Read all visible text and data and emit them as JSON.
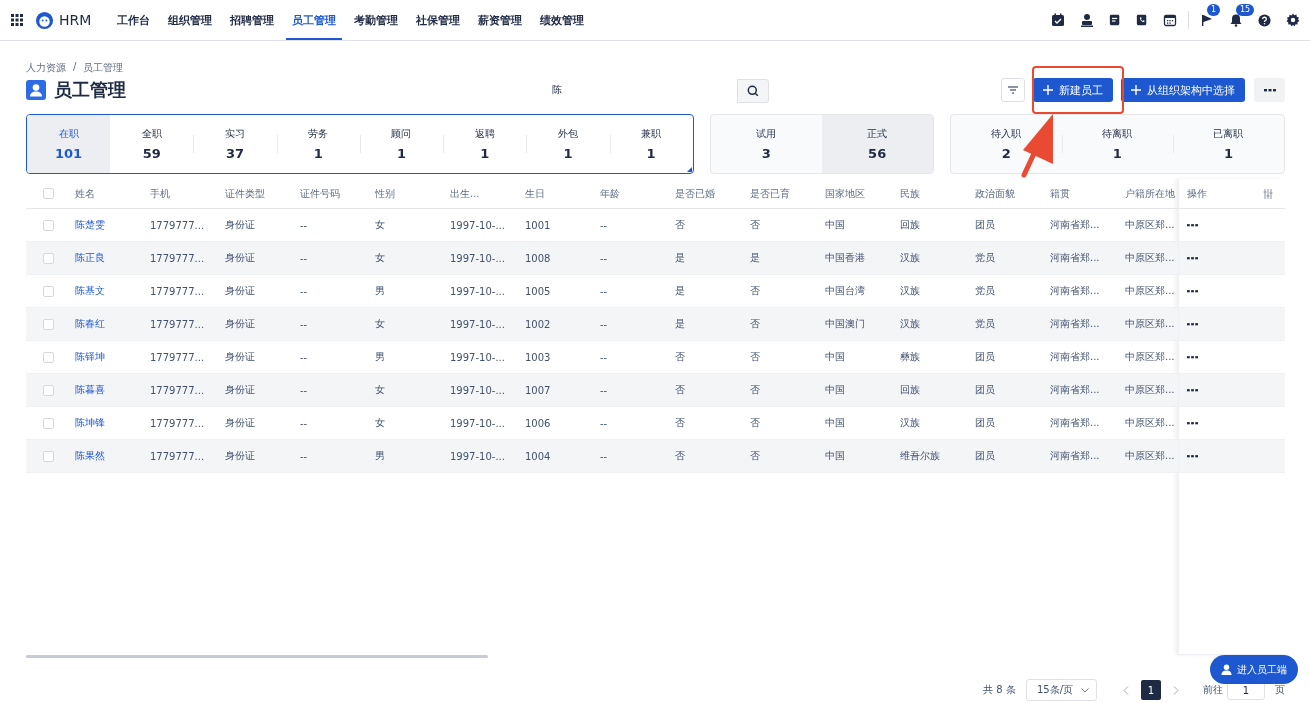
{
  "app": {
    "name": "HRM"
  },
  "nav": [
    {
      "label": "工作台",
      "selected": false
    },
    {
      "label": "组织管理",
      "selected": false
    },
    {
      "label": "招聘管理",
      "selected": false
    },
    {
      "label": "员工管理",
      "selected": true
    },
    {
      "label": "考勤管理",
      "selected": false
    },
    {
      "label": "社保管理",
      "selected": false
    },
    {
      "label": "薪资管理",
      "selected": false
    },
    {
      "label": "绩效管理",
      "selected": false
    }
  ],
  "header_badges": {
    "flag": "1",
    "bell": "15"
  },
  "breadcrumb": [
    "人力资源",
    "员工管理"
  ],
  "breadcrumb_separator": "/",
  "page_title": "员工管理",
  "search": {
    "value": "陈"
  },
  "buttons": {
    "primary": [
      "新建员工",
      "从组织架构中选择"
    ]
  },
  "stat_groups": [
    {
      "items": [
        {
          "label": "在职",
          "value": "101",
          "selected": true
        },
        {
          "label": "全职",
          "value": "59",
          "selected": false
        },
        {
          "label": "实习",
          "value": "37",
          "selected": false
        },
        {
          "label": "劳务",
          "value": "1",
          "selected": false
        },
        {
          "label": "顾问",
          "value": "1",
          "selected": false
        },
        {
          "label": "返聘",
          "value": "1",
          "selected": false
        },
        {
          "label": "外包",
          "value": "1",
          "selected": false
        },
        {
          "label": "兼职",
          "value": "1",
          "selected": false
        }
      ]
    },
    {
      "items": [
        {
          "label": "试用",
          "value": "3",
          "selected": false
        },
        {
          "label": "正式",
          "value": "56",
          "selected": true
        }
      ]
    },
    {
      "items": [
        {
          "label": "待入职",
          "value": "2",
          "selected": false
        },
        {
          "label": "待离职",
          "value": "1",
          "selected": false
        },
        {
          "label": "已离职",
          "value": "1",
          "selected": false
        }
      ]
    }
  ],
  "table": {
    "select_all_checked": false,
    "columns": [
      "姓名",
      "手机",
      "证件类型",
      "证件号码",
      "性别",
      "出生...",
      "生日",
      "年龄",
      "是否已婚",
      "是否已育",
      "国家地区",
      "民族",
      "政治面貌",
      "籍贯",
      "户籍所在地"
    ],
    "action_column": "操作",
    "rows": [
      {
        "checked": false,
        "cells": [
          "陈楚雯",
          "1779777...",
          "身份证",
          "--",
          "女",
          "1997-10-...",
          "1001",
          "--",
          "否",
          "否",
          "中国",
          "回族",
          "团员",
          "河南省郑...",
          "中原区郑..."
        ]
      },
      {
        "checked": false,
        "cells": [
          "陈正良",
          "1779777...",
          "身份证",
          "--",
          "女",
          "1997-10-...",
          "1008",
          "--",
          "是",
          "是",
          "中国香港",
          "汉族",
          "党员",
          "河南省郑...",
          "中原区郑..."
        ]
      },
      {
        "checked": false,
        "cells": [
          "陈基文",
          "1779777...",
          "身份证",
          "--",
          "男",
          "1997-10-...",
          "1005",
          "--",
          "是",
          "否",
          "中国台湾",
          "汉族",
          "党员",
          "河南省郑...",
          "中原区郑..."
        ]
      },
      {
        "checked": false,
        "cells": [
          "陈春红",
          "1779777...",
          "身份证",
          "--",
          "女",
          "1997-10-...",
          "1002",
          "--",
          "是",
          "否",
          "中国澳门",
          "汉族",
          "党员",
          "河南省郑...",
          "中原区郑..."
        ]
      },
      {
        "checked": false,
        "cells": [
          "陈铎坤",
          "1779777...",
          "身份证",
          "--",
          "男",
          "1997-10-...",
          "1003",
          "--",
          "否",
          "否",
          "中国",
          "彝族",
          "团员",
          "河南省郑...",
          "中原区郑..."
        ]
      },
      {
        "checked": false,
        "cells": [
          "陈暮喜",
          "1779777...",
          "身份证",
          "--",
          "女",
          "1997-10-...",
          "1007",
          "--",
          "否",
          "否",
          "中国",
          "回族",
          "团员",
          "河南省郑...",
          "中原区郑..."
        ]
      },
      {
        "checked": false,
        "cells": [
          "陈坤锋",
          "1779777...",
          "身份证",
          "--",
          "女",
          "1997-10-...",
          "1006",
          "--",
          "否",
          "否",
          "中国",
          "汉族",
          "团员",
          "河南省郑...",
          "中原区郑..."
        ]
      },
      {
        "checked": false,
        "cells": [
          "陈果然",
          "1779777...",
          "身份证",
          "--",
          "男",
          "1997-10-...",
          "1004",
          "--",
          "否",
          "否",
          "中国",
          "维吾尔族",
          "团员",
          "河南省郑...",
          "中原区郑..."
        ]
      }
    ]
  },
  "pagination": {
    "total": "共 8 条",
    "page_size": "15条/页",
    "pages": [
      {
        "label": "1",
        "selected": true
      }
    ],
    "goto_label": "前往",
    "goto_value": "1",
    "goto_suffix": "页"
  },
  "float_button": "进入员工端"
}
